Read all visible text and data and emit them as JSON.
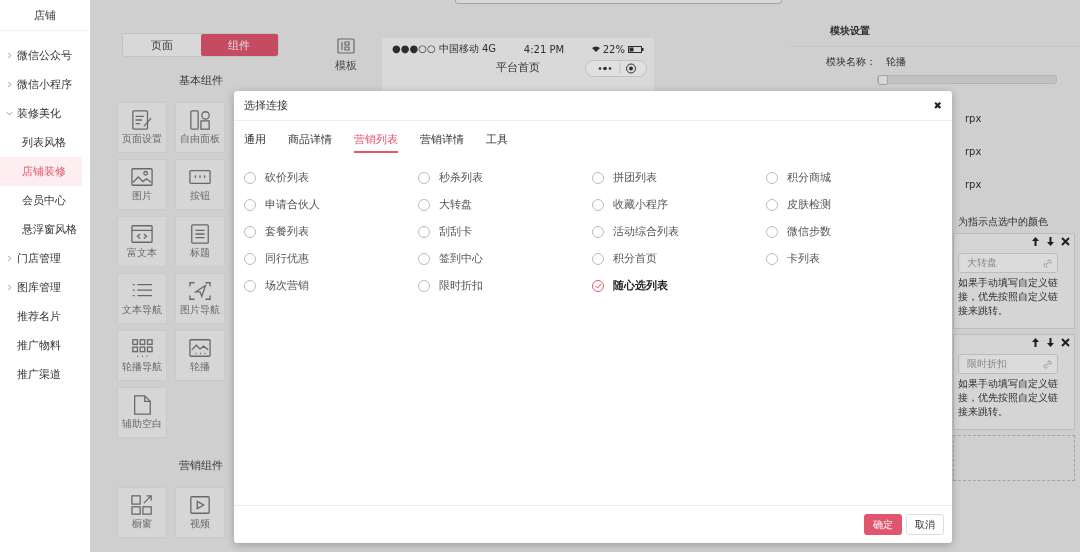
{
  "sidebar": {
    "title": "店铺",
    "items": [
      {
        "label": "微信公众号",
        "kind": "group",
        "expanded": false
      },
      {
        "label": "微信小程序",
        "kind": "group",
        "expanded": false
      },
      {
        "label": "装修美化",
        "kind": "group",
        "expanded": true,
        "children": [
          {
            "label": "列表风格",
            "selected": false
          },
          {
            "label": "店铺装修",
            "selected": true
          },
          {
            "label": "会员中心",
            "selected": false
          },
          {
            "label": "悬浮窗风格",
            "selected": false
          }
        ]
      },
      {
        "label": "门店管理",
        "kind": "group",
        "expanded": false
      },
      {
        "label": "图库管理",
        "kind": "group",
        "expanded": false
      },
      {
        "label": "推荐名片",
        "kind": "link"
      },
      {
        "label": "推广物料",
        "kind": "link"
      },
      {
        "label": "推广渠道",
        "kind": "link"
      }
    ]
  },
  "component_panel": {
    "tabs": [
      {
        "label": "页面",
        "selected": false
      },
      {
        "label": "组件",
        "selected": true
      }
    ],
    "sections": [
      {
        "title": "基本组件",
        "items": [
          "页面设置",
          "自由面板",
          "图片",
          "按钮",
          "富文本",
          "标题",
          "文本导航",
          "图片导航",
          "轮播导航",
          "轮播",
          "辅助空白"
        ]
      },
      {
        "title": "营销组件",
        "items": [
          "橱窗",
          "视频"
        ]
      }
    ]
  },
  "preview": {
    "template_button": "模板",
    "status_bar": {
      "carrier": "●●●○○ 中国移动 4G",
      "time": "4:21 PM",
      "battery": "22%"
    },
    "title": "平台首页"
  },
  "module_settings": {
    "title": "模块设置",
    "name_label": "模块名称：",
    "name_value": "轮播",
    "margin_slider": {
      "level": 0
    },
    "units": [
      "rpx",
      "rpx",
      "rpx"
    ],
    "color_hint": "为指示点选中的颜色",
    "slides": [
      {
        "link": "大转盘",
        "hint": "如果手动填写自定义链接，优先按照自定义链接来跳转。"
      },
      {
        "link": "限时折扣",
        "hint": "如果手动填写自定义链接，优先按照自定义链接来跳转。"
      }
    ]
  },
  "dialog": {
    "title": "选择连接",
    "close": "✖",
    "tabs": [
      {
        "label": "通用",
        "selected": false
      },
      {
        "label": "商品详情",
        "selected": false
      },
      {
        "label": "营销列表",
        "selected": true
      },
      {
        "label": "营销详情",
        "selected": false
      },
      {
        "label": "工具",
        "selected": false
      }
    ],
    "options": [
      {
        "label": "砍价列表",
        "selected": false
      },
      {
        "label": "秒杀列表",
        "selected": false
      },
      {
        "label": "拼团列表",
        "selected": false
      },
      {
        "label": "积分商城",
        "selected": false
      },
      {
        "label": "申请合伙人",
        "selected": false
      },
      {
        "label": "大转盘",
        "selected": false
      },
      {
        "label": "收藏小程序",
        "selected": false
      },
      {
        "label": "皮肤检测",
        "selected": false
      },
      {
        "label": "套餐列表",
        "selected": false
      },
      {
        "label": "刮刮卡",
        "selected": false
      },
      {
        "label": "活动综合列表",
        "selected": false
      },
      {
        "label": "微信步数",
        "selected": false
      },
      {
        "label": "同行优惠",
        "selected": false
      },
      {
        "label": "签到中心",
        "selected": false
      },
      {
        "label": "积分首页",
        "selected": false
      },
      {
        "label": "卡列表",
        "selected": false
      },
      {
        "label": "场次营销",
        "selected": false
      },
      {
        "label": "限时折扣",
        "selected": false
      },
      {
        "label": "随心选列表",
        "selected": true
      }
    ],
    "confirm": "确定",
    "cancel": "取消"
  }
}
